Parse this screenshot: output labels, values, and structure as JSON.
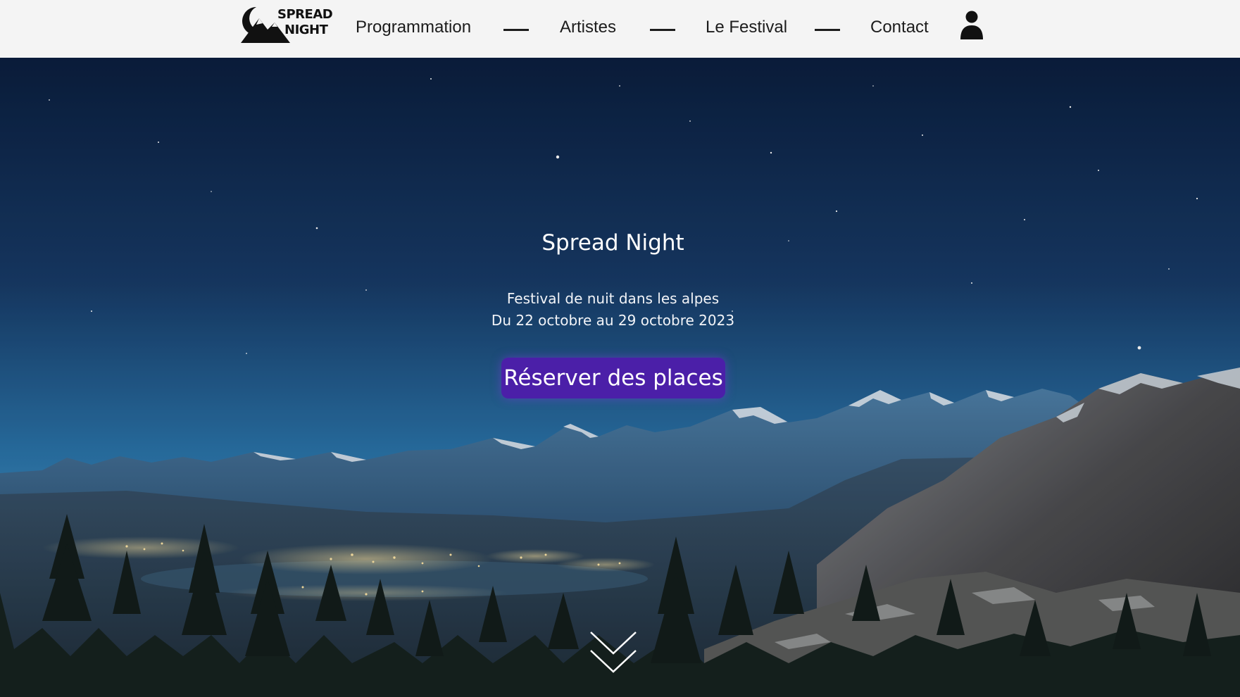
{
  "header": {
    "logo": {
      "line1": "SPREAD",
      "line2": "NIGHT"
    },
    "nav": [
      {
        "label": "Programmation"
      },
      {
        "label": "Artistes"
      },
      {
        "label": "Le Festival"
      },
      {
        "label": "Contact"
      }
    ],
    "user_icon": "user-icon"
  },
  "hero": {
    "title": "Spread Night",
    "subtitle_line1": "Festival de nuit dans les alpes",
    "subtitle_line2": "Du 22 octobre au 29 octobre 2023",
    "cta_label": "Réserver des places",
    "scroll_icon": "double-chevron-down-icon"
  },
  "colors": {
    "header_bg": "#f4f4f4",
    "nav_text": "#1c1c1c",
    "cta_bg": "#4b1fa8",
    "sky_top": "#0b1e3e",
    "sky_bottom": "#2f7fb4"
  }
}
